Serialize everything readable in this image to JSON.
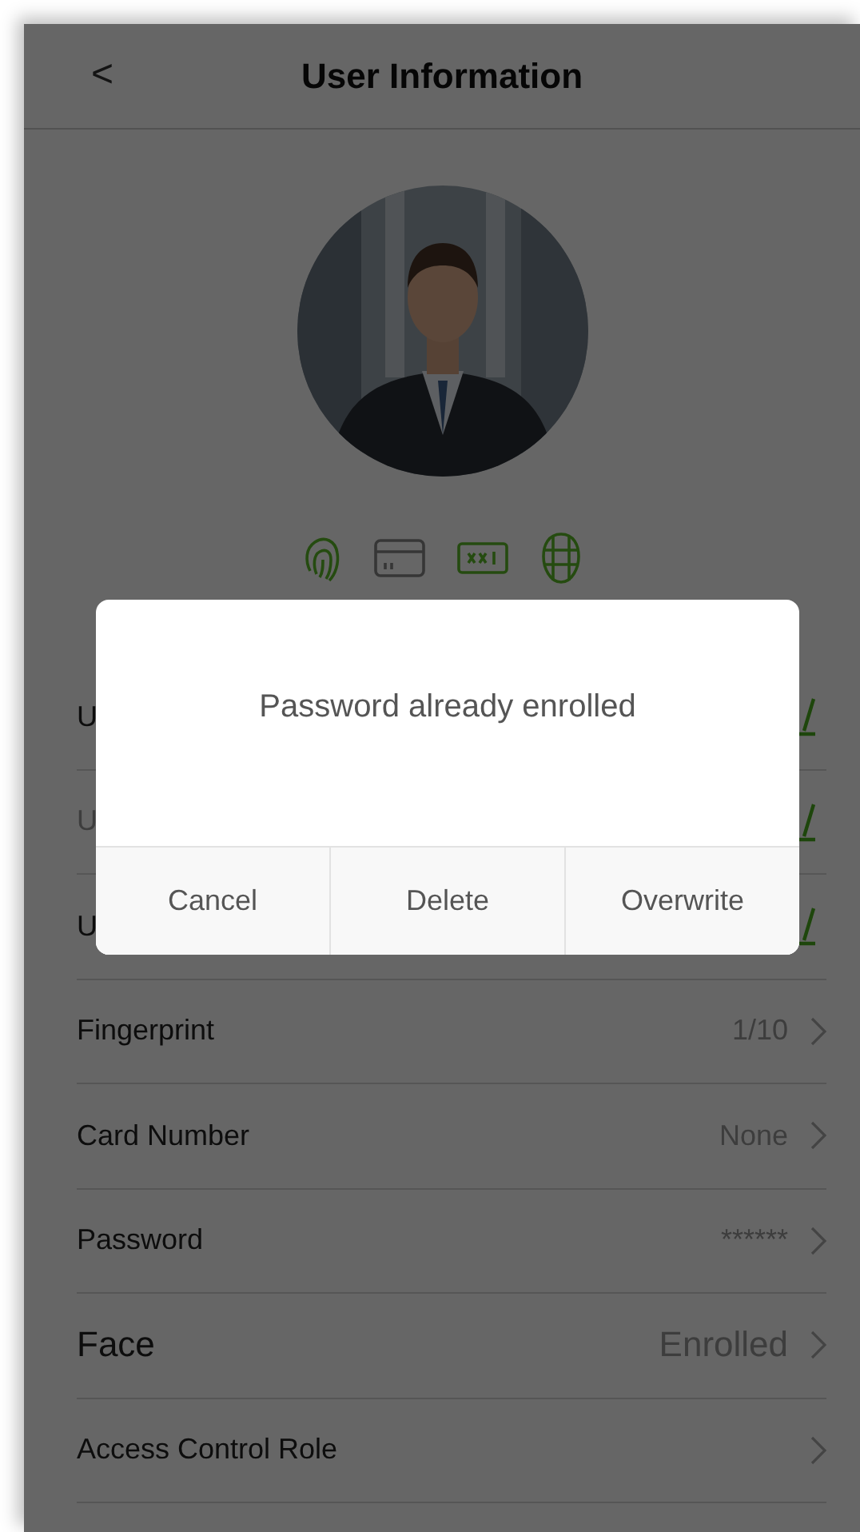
{
  "header": {
    "back": "<",
    "title": "User Information"
  },
  "credentials": [
    {
      "kind": "fingerprint",
      "enrolled": true
    },
    {
      "kind": "card",
      "enrolled": false
    },
    {
      "kind": "password",
      "enrolled": true
    },
    {
      "kind": "face",
      "enrolled": true
    }
  ],
  "rows": [
    {
      "label": "U",
      "dimmed": false,
      "kind": "edit"
    },
    {
      "label": "U",
      "dimmed": true,
      "kind": "edit"
    },
    {
      "label": "U",
      "dimmed": false,
      "kind": "edit"
    },
    {
      "label": "Fingerprint",
      "value": "1/10",
      "kind": "link",
      "large": false
    },
    {
      "label": "Card Number",
      "value": "None",
      "kind": "link",
      "large": false
    },
    {
      "label": "Password",
      "value": "******",
      "kind": "link",
      "large": false
    },
    {
      "label": "Face",
      "value": "Enrolled",
      "kind": "link",
      "large": true
    },
    {
      "label": "Access Control Role",
      "kind": "link",
      "large": false
    }
  ],
  "dialog": {
    "message": "Password already enrolled",
    "buttons": [
      "Cancel",
      "Delete",
      "Overwrite"
    ]
  }
}
